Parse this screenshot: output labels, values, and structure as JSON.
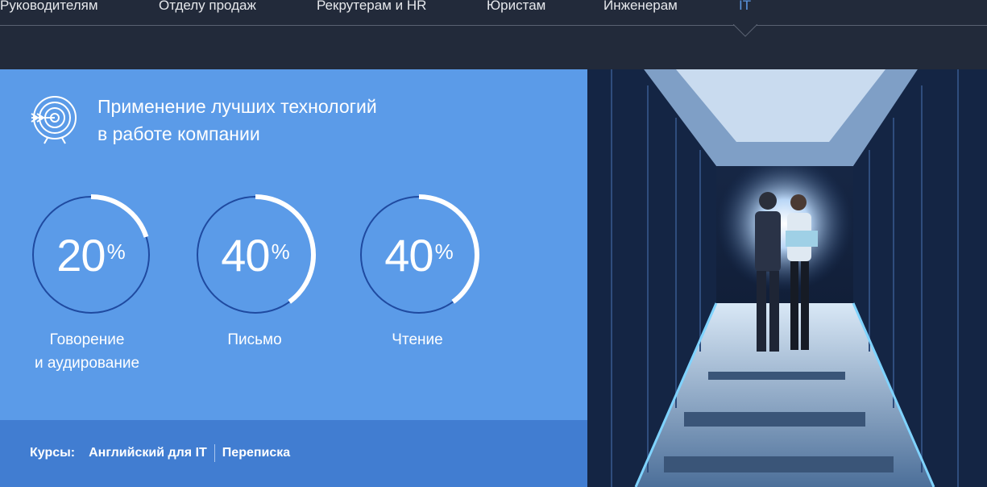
{
  "nav": {
    "items": [
      {
        "label": "Руководителям"
      },
      {
        "label": "Отделу продаж"
      },
      {
        "label": "Рекрутерам и HR"
      },
      {
        "label": "Юристам"
      },
      {
        "label": "Инженерам"
      },
      {
        "label": "IT"
      }
    ],
    "active_index": 5,
    "active_color": "#5b95e0"
  },
  "panel": {
    "heading_line1": "Применение лучших технологий",
    "heading_line2": "в работе компании",
    "heading_icon": "target-arrow-icon",
    "background_color": "#5b9be8",
    "stats": [
      {
        "value": "20",
        "unit": "%",
        "fraction": 0.2,
        "label_line1": "Говорение",
        "label_line2": "и аудирование"
      },
      {
        "value": "40",
        "unit": "%",
        "fraction": 0.4,
        "label_line1": "Письмо",
        "label_line2": ""
      },
      {
        "value": "40",
        "unit": "%",
        "fraction": 0.4,
        "label_line1": "Чтение",
        "label_line2": ""
      }
    ]
  },
  "footer": {
    "courses_label": "Курсы:",
    "links": [
      "Английский для IT",
      "Переписка"
    ]
  },
  "photo": {
    "subject": "server-room-corridor-image"
  }
}
